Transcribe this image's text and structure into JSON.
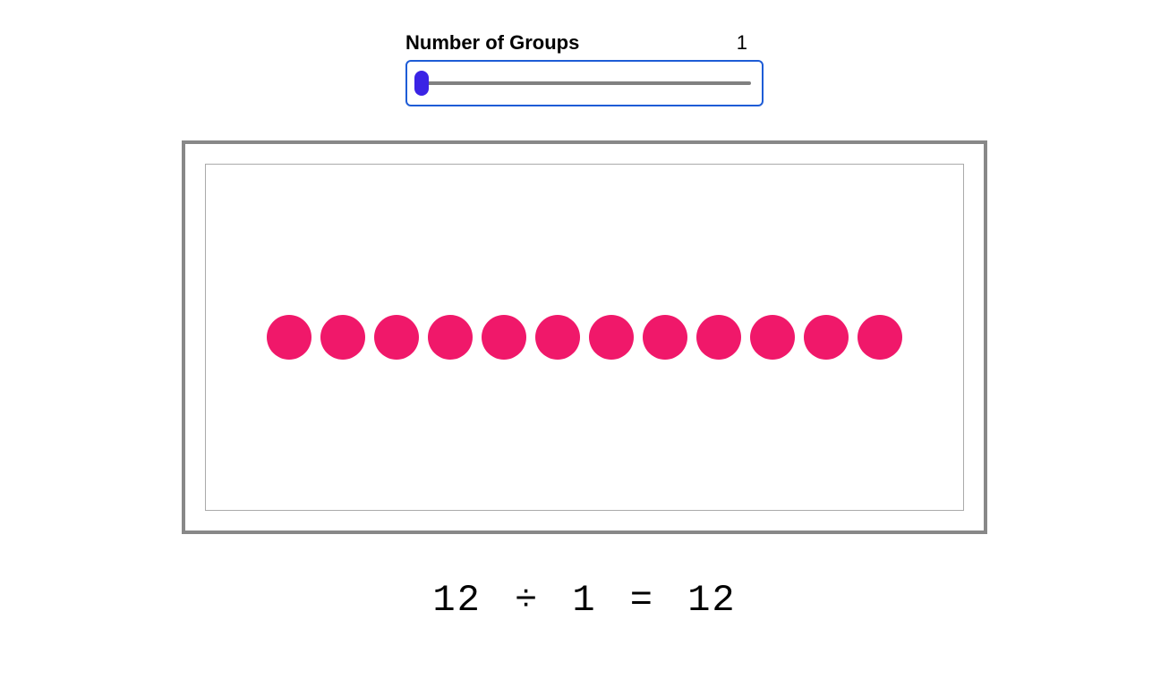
{
  "slider": {
    "label": "Number of Groups",
    "value": "1",
    "min": 1,
    "max": 12
  },
  "visualization": {
    "total_items": 12,
    "groups": 1,
    "items_per_group": 12,
    "dot_color": "#f0186a"
  },
  "equation": {
    "dividend": "12",
    "divisor": "1",
    "quotient": "12",
    "text": "12 ÷ 1 = 12"
  }
}
